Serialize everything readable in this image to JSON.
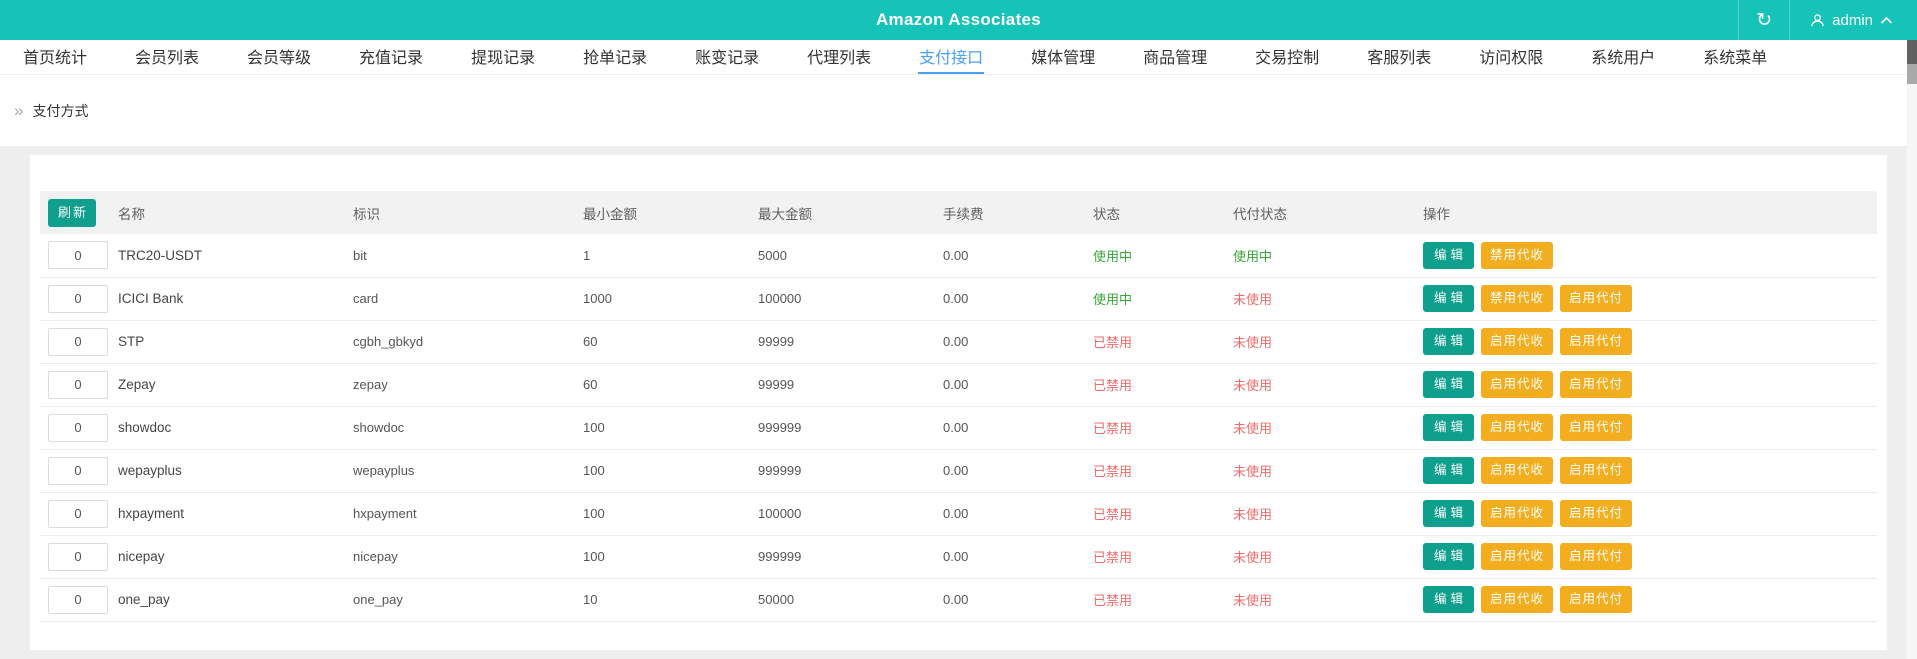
{
  "header": {
    "title": "Amazon Associates",
    "user": "admin",
    "colors": {
      "topbar_teal": "#15c3b9",
      "active_link_blue": "#4aa0f5",
      "primary_button_teal": "#0f9f8d",
      "warning_button_amber": "#f3ae1f",
      "status_on_green": "#39a639",
      "status_off_red": "#f06b6b"
    }
  },
  "nav": {
    "items": [
      {
        "label": "首页统计",
        "active": false
      },
      {
        "label": "会员列表",
        "active": false
      },
      {
        "label": "会员等级",
        "active": false
      },
      {
        "label": "充值记录",
        "active": false
      },
      {
        "label": "提现记录",
        "active": false
      },
      {
        "label": "抢单记录",
        "active": false
      },
      {
        "label": "账变记录",
        "active": false
      },
      {
        "label": "代理列表",
        "active": false
      },
      {
        "label": "支付接口",
        "active": true
      },
      {
        "label": "媒体管理",
        "active": false
      },
      {
        "label": "商品管理",
        "active": false
      },
      {
        "label": "交易控制",
        "active": false
      },
      {
        "label": "客服列表",
        "active": false
      },
      {
        "label": "访问权限",
        "active": false
      },
      {
        "label": "系统用户",
        "active": false
      },
      {
        "label": "系统菜单",
        "active": false
      }
    ]
  },
  "breadcrumb": {
    "label": "支付方式"
  },
  "table": {
    "refresh_label": "刷新",
    "columns": [
      "名称",
      "标识",
      "最小金额",
      "最大金额",
      "手续费",
      "状态",
      "代付状态",
      "操作"
    ],
    "rows": [
      {
        "sort": "0",
        "name": "TRC20-USDT",
        "code": "bit",
        "min": "1",
        "max": "5000",
        "fee": "0.00",
        "status": {
          "text": "使用中",
          "state": "on"
        },
        "pay_status": {
          "text": "使用中",
          "state": "on"
        },
        "actions": [
          {
            "label": "编辑",
            "type": "primary"
          },
          {
            "label": "禁用代收",
            "type": "warning"
          }
        ]
      },
      {
        "sort": "0",
        "name": "ICICI Bank",
        "code": "card",
        "min": "1000",
        "max": "100000",
        "fee": "0.00",
        "status": {
          "text": "使用中",
          "state": "on"
        },
        "pay_status": {
          "text": "未使用",
          "state": "off"
        },
        "actions": [
          {
            "label": "编辑",
            "type": "primary"
          },
          {
            "label": "禁用代收",
            "type": "warning"
          },
          {
            "label": "启用代付",
            "type": "warning"
          }
        ]
      },
      {
        "sort": "0",
        "name": "STP",
        "code": "cgbh_gbkyd",
        "min": "60",
        "max": "99999",
        "fee": "0.00",
        "status": {
          "text": "已禁用",
          "state": "off"
        },
        "pay_status": {
          "text": "未使用",
          "state": "off"
        },
        "actions": [
          {
            "label": "编辑",
            "type": "primary"
          },
          {
            "label": "启用代收",
            "type": "warning"
          },
          {
            "label": "启用代付",
            "type": "warning"
          }
        ]
      },
      {
        "sort": "0",
        "name": "Zepay",
        "code": "zepay",
        "min": "60",
        "max": "99999",
        "fee": "0.00",
        "status": {
          "text": "已禁用",
          "state": "off"
        },
        "pay_status": {
          "text": "未使用",
          "state": "off"
        },
        "actions": [
          {
            "label": "编辑",
            "type": "primary"
          },
          {
            "label": "启用代收",
            "type": "warning"
          },
          {
            "label": "启用代付",
            "type": "warning"
          }
        ]
      },
      {
        "sort": "0",
        "name": "showdoc",
        "code": "showdoc",
        "min": "100",
        "max": "999999",
        "fee": "0.00",
        "status": {
          "text": "已禁用",
          "state": "off"
        },
        "pay_status": {
          "text": "未使用",
          "state": "off"
        },
        "actions": [
          {
            "label": "编辑",
            "type": "primary"
          },
          {
            "label": "启用代收",
            "type": "warning"
          },
          {
            "label": "启用代付",
            "type": "warning"
          }
        ]
      },
      {
        "sort": "0",
        "name": "wepayplus",
        "code": "wepayplus",
        "min": "100",
        "max": "999999",
        "fee": "0.00",
        "status": {
          "text": "已禁用",
          "state": "off"
        },
        "pay_status": {
          "text": "未使用",
          "state": "off"
        },
        "actions": [
          {
            "label": "编辑",
            "type": "primary"
          },
          {
            "label": "启用代收",
            "type": "warning"
          },
          {
            "label": "启用代付",
            "type": "warning"
          }
        ]
      },
      {
        "sort": "0",
        "name": "hxpayment",
        "code": "hxpayment",
        "min": "100",
        "max": "100000",
        "fee": "0.00",
        "status": {
          "text": "已禁用",
          "state": "off"
        },
        "pay_status": {
          "text": "未使用",
          "state": "off"
        },
        "actions": [
          {
            "label": "编辑",
            "type": "primary"
          },
          {
            "label": "启用代收",
            "type": "warning"
          },
          {
            "label": "启用代付",
            "type": "warning"
          }
        ]
      },
      {
        "sort": "0",
        "name": "nicepay",
        "code": "nicepay",
        "min": "100",
        "max": "999999",
        "fee": "0.00",
        "status": {
          "text": "已禁用",
          "state": "off"
        },
        "pay_status": {
          "text": "未使用",
          "state": "off"
        },
        "actions": [
          {
            "label": "编辑",
            "type": "primary"
          },
          {
            "label": "启用代收",
            "type": "warning"
          },
          {
            "label": "启用代付",
            "type": "warning"
          }
        ]
      },
      {
        "sort": "0",
        "name": "one_pay",
        "code": "one_pay",
        "min": "10",
        "max": "50000",
        "fee": "0.00",
        "status": {
          "text": "已禁用",
          "state": "off"
        },
        "pay_status": {
          "text": "未使用",
          "state": "off"
        },
        "actions": [
          {
            "label": "编辑",
            "type": "primary"
          },
          {
            "label": "启用代收",
            "type": "warning"
          },
          {
            "label": "启用代付",
            "type": "warning"
          }
        ]
      }
    ]
  }
}
